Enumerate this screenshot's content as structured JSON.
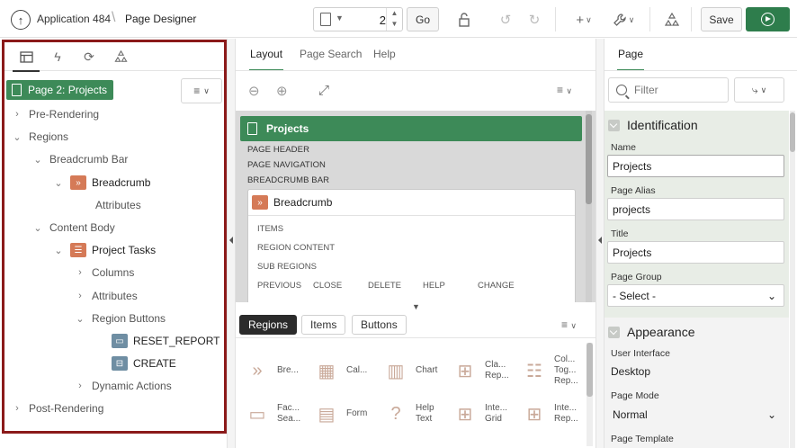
{
  "header": {
    "app_name": "Application 484",
    "page_title": "Page Designer",
    "page_number": "2",
    "go_label": "Go",
    "save_label": "Save"
  },
  "left": {
    "page_badge": "Page 2: Projects",
    "tree": {
      "pre_rendering": "Pre-Rendering",
      "regions": "Regions",
      "breadcrumb_bar": "Breadcrumb Bar",
      "breadcrumb": "Breadcrumb",
      "breadcrumb_attributes": "Attributes",
      "content_body": "Content Body",
      "project_tasks": "Project Tasks",
      "columns": "Columns",
      "attributes": "Attributes",
      "region_buttons": "Region Buttons",
      "reset_report": "RESET_REPORT",
      "create": "CREATE",
      "dynamic_actions": "Dynamic Actions",
      "post_rendering": "Post-Rendering"
    }
  },
  "middle": {
    "tabs": [
      "Layout",
      "Page Search",
      "Help"
    ],
    "page_title": "Projects",
    "labels": {
      "page_header": "PAGE HEADER",
      "page_navigation": "PAGE NAVIGATION",
      "breadcrumb_bar": "BREADCRUMB BAR"
    },
    "region": {
      "title": "Breadcrumb",
      "items": "ITEMS",
      "region_content": "REGION CONTENT",
      "sub_regions": "SUB REGIONS",
      "buttons_row": [
        "PREVIOUS",
        "CLOSE",
        "DELETE",
        "HELP",
        "CHANGE"
      ]
    },
    "gallery_tabs": [
      "Regions",
      "Items",
      "Buttons"
    ],
    "gallery": [
      {
        "label": "Bre..."
      },
      {
        "label": "Cal..."
      },
      {
        "label": "Chart"
      },
      {
        "label": "Cla...\nRep..."
      },
      {
        "label": "Col...\nTog...\nRep..."
      },
      {
        "label": "Fac...\nSea..."
      },
      {
        "label": "Form"
      },
      {
        "label": "Help\nText"
      },
      {
        "label": "Inte...\nGrid"
      },
      {
        "label": "Inte...\nRep..."
      }
    ]
  },
  "right": {
    "tab": "Page",
    "filter_placeholder": "Filter",
    "identification": {
      "title": "Identification",
      "name_label": "Name",
      "name_value": "Projects",
      "alias_label": "Page Alias",
      "alias_value": "projects",
      "title_label": "Title",
      "title_value": "Projects",
      "group_label": "Page Group",
      "group_value": "- Select -"
    },
    "appearance": {
      "title": "Appearance",
      "ui_label": "User Interface",
      "ui_value": "Desktop",
      "mode_label": "Page Mode",
      "mode_value": "Normal",
      "template_label": "Page Template"
    }
  },
  "colors": {
    "accent_green": "#3d8a58",
    "run_green": "#2e7d4c",
    "highlight_border": "#8b1a1a",
    "region_icon": "#d57a57",
    "button_icon": "#6f8ea3"
  }
}
